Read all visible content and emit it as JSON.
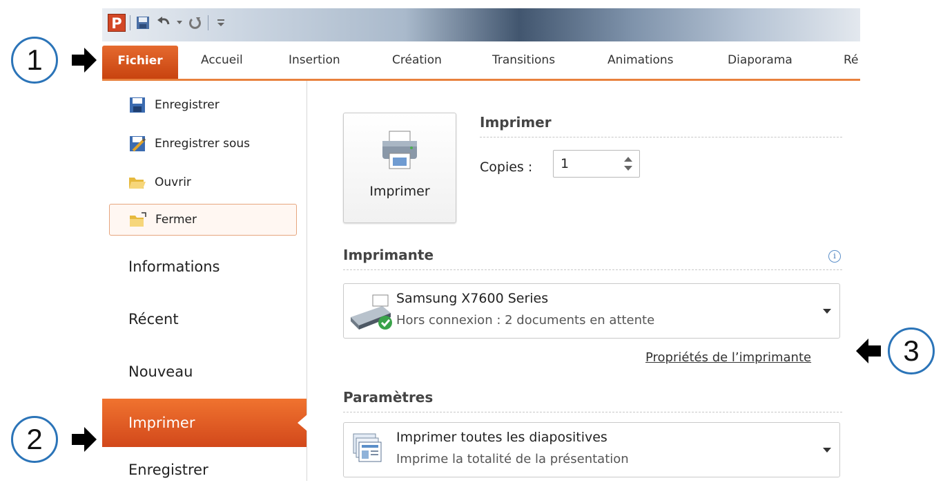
{
  "quick_access": {
    "app_icon": "powerpoint-icon",
    "app_letter": "P",
    "buttons": [
      "save-icon",
      "undo-icon",
      "redo-icon",
      "customize-icon"
    ]
  },
  "ribbon": {
    "tabs": [
      {
        "label": "Fichier",
        "selected": true
      },
      {
        "label": "Accueil"
      },
      {
        "label": "Insertion"
      },
      {
        "label": "Création"
      },
      {
        "label": "Transitions"
      },
      {
        "label": "Animations"
      },
      {
        "label": "Diaporama"
      },
      {
        "label": "Ré"
      }
    ]
  },
  "backstage": {
    "commands": [
      {
        "label": "Enregistrer",
        "icon": "save-icon"
      },
      {
        "label": "Enregistrer sous",
        "icon": "save-as-icon"
      },
      {
        "label": "Ouvrir",
        "icon": "open-folder-icon"
      },
      {
        "label": "Fermer",
        "icon": "close-folder-icon",
        "highlighted": true
      }
    ],
    "nav": [
      {
        "label": "Informations"
      },
      {
        "label": "Récent"
      },
      {
        "label": "Nouveau"
      },
      {
        "label": "Imprimer",
        "selected": true
      },
      {
        "label": "Enregistrer"
      }
    ]
  },
  "print": {
    "print_button_label": "Imprimer",
    "section_title": "Imprimer",
    "copies_label": "Copies :",
    "copies_value": "1",
    "printer_section_title": "Imprimante",
    "printer_name": "Samsung X7600 Series",
    "printer_status": "Hors connexion : 2 documents en attente",
    "printer_properties_link": "Propriétés de l’imprimante",
    "settings_section_title": "Paramètres",
    "setting_slides_title": "Imprimer toutes les diapositives",
    "setting_slides_desc": "Imprime la totalité de la présentation"
  },
  "annotations": {
    "step1": "1",
    "step2": "2",
    "step3": "3"
  },
  "colors": {
    "accent_orange": "#d2481b",
    "annotation_blue": "#2b74b8"
  }
}
